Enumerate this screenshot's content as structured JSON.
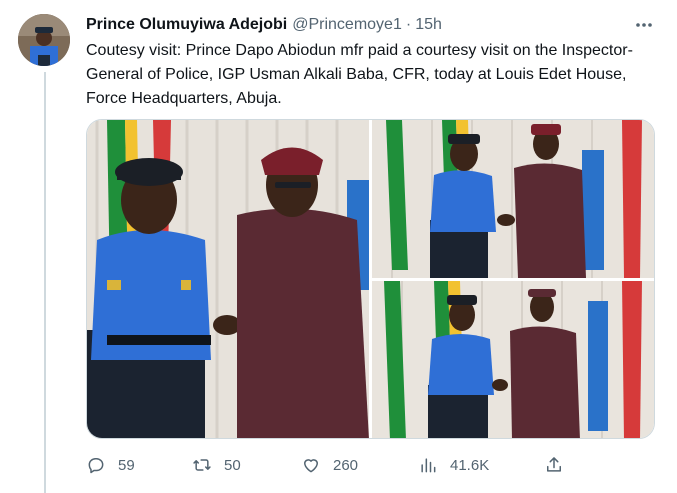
{
  "tweet": {
    "author_name": "Prince Olumuyiwa Adejobi",
    "handle": "@Princemoye1",
    "separator": "·",
    "time": "15h",
    "text": "Coutesy visit: Prince Dapo Abiodun mfr paid a courtesy visit on the Inspector-General of Police, IGP Usman Alkali Baba, CFR, today at Louis Edet House, Force Headquarters, Abuja."
  },
  "actions": {
    "replies": "59",
    "retweets": "50",
    "likes": "260",
    "views": "41.6K"
  },
  "icons": {
    "more": "more-horizontal-icon",
    "reply": "reply-icon",
    "retweet": "retweet-icon",
    "like": "heart-icon",
    "views": "views-chart-icon",
    "share": "share-icon"
  },
  "colors": {
    "text_primary": "#0f1419",
    "text_secondary": "#536471",
    "border": "#cfd9de",
    "police_uniform": "#2f6fd6",
    "agbada": "#5a2a33",
    "cap": "#7a1f2b"
  }
}
